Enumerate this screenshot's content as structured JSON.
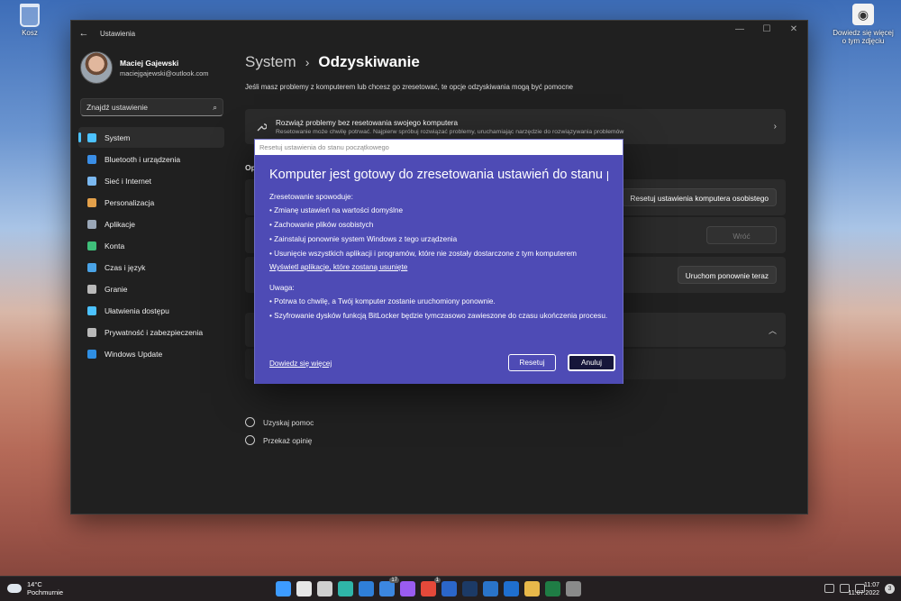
{
  "desktop": {
    "recycle_bin": "Kosz",
    "learn_more": "Dowiedz się więcej o tym zdjęciu"
  },
  "window": {
    "title": "Ustawienia",
    "controls": [
      "—",
      "☐",
      "✕"
    ]
  },
  "profile": {
    "name": "Maciej Gajewski",
    "email": "maciejgajewski@outlook.com"
  },
  "search": {
    "placeholder": "Znajdź ustawienie"
  },
  "nav": [
    {
      "label": "System",
      "icon": "monitor-icon",
      "color": "#4cc2ff"
    },
    {
      "label": "Bluetooth i urządzenia",
      "icon": "bluetooth-icon",
      "color": "#3a8ee6"
    },
    {
      "label": "Sieć i Internet",
      "icon": "wifi-icon",
      "color": "#7ab8f0"
    },
    {
      "label": "Personalizacja",
      "icon": "brush-icon",
      "color": "#e3a04a"
    },
    {
      "label": "Aplikacje",
      "icon": "apps-icon",
      "color": "#9aa7b8"
    },
    {
      "label": "Konta",
      "icon": "person-icon",
      "color": "#3fbf7a"
    },
    {
      "label": "Czas i język",
      "icon": "globe-clock-icon",
      "color": "#4aa3e6"
    },
    {
      "label": "Granie",
      "icon": "gamepad-icon",
      "color": "#b9b9b9"
    },
    {
      "label": "Ułatwienia dostępu",
      "icon": "accessibility-icon",
      "color": "#4cc2ff"
    },
    {
      "label": "Prywatność i zabezpieczenia",
      "icon": "shield-icon",
      "color": "#b9b9b9"
    },
    {
      "label": "Windows Update",
      "icon": "update-icon",
      "color": "#2f8fe3"
    }
  ],
  "main": {
    "breadcrumb_parent": "System",
    "breadcrumb_sep": "›",
    "breadcrumb_current": "Odzyskiwanie",
    "description": "Jeśli masz problemy z komputerem lub chcesz go zresetować, te opcje odzyskiwania mogą być pomocne",
    "fix_title": "Rozwiąż problemy bez resetowania swojego komputera",
    "fix_subtitle": "Resetowanie może chwilę potrwać. Najpierw spróbuj rozwiązać problemy, uruchamiając narzędzie do rozwiązywania problemów",
    "options_label": "Op",
    "reset_button": "Resetuj ustawienia komputera osobistego",
    "back_button": "Wróć",
    "restart_button": "Uruchom ponownie teraz",
    "help_link": "Uzyskaj pomoc",
    "feedback_link": "Przekaż opinię"
  },
  "dialog": {
    "titlebar": "Resetuj ustawienia do stanu początkowego",
    "heading": "Komputer jest gotowy do zresetowania ustawień do stanu p...",
    "intro": "Zresetowanie spowoduje:",
    "effects": [
      "Zmianę ustawień na wartości domyślne",
      "Zachowanie plików osobistych",
      "Zainstaluj ponownie system Windows z tego urządzenia",
      "Usunięcie wszystkich aplikacji i programów, które nie zostały dostarczone z tym komputerem"
    ],
    "apps_link": "Wyświetl aplikacje, które zostaną usunięte",
    "note_label": "Uwaga:",
    "notes": [
      "Potrwa to chwilę, a Twój komputer zostanie uruchomiony ponownie.",
      "Szyfrowanie dysków funkcją BitLocker będzie tymczasowo zawieszone do czasu ukończenia procesu."
    ],
    "learn_more": "Dowiedz się więcej",
    "reset": "Resetuj",
    "cancel": "Anuluj"
  },
  "taskbar": {
    "temperature": "14°C",
    "condition": "Pochmurnie",
    "apps": [
      {
        "icon": "windows-start-icon",
        "color": "#3d9bff",
        "badge": ""
      },
      {
        "icon": "search-icon",
        "color": "#e6e6e6",
        "badge": ""
      },
      {
        "icon": "task-view-icon",
        "color": "#cfcfcf",
        "badge": ""
      },
      {
        "icon": "edge-icon",
        "color": "#2fb5a8",
        "badge": ""
      },
      {
        "icon": "mail-icon",
        "color": "#2f7fd8",
        "badge": ""
      },
      {
        "icon": "calendar-icon",
        "color": "#3c87e0",
        "badge": "17"
      },
      {
        "icon": "messenger-icon",
        "color": "#9a5cf0",
        "badge": ""
      },
      {
        "icon": "chrome-icon",
        "color": "#e5493a",
        "badge": "1"
      },
      {
        "icon": "word-icon",
        "color": "#2b66c9",
        "badge": ""
      },
      {
        "icon": "photoshop-icon",
        "color": "#1c3a66",
        "badge": ""
      },
      {
        "icon": "trello-icon",
        "color": "#2a74c9",
        "badge": ""
      },
      {
        "icon": "outlook-icon",
        "color": "#1f6fcf",
        "badge": ""
      },
      {
        "icon": "explorer-icon",
        "color": "#e8b84a",
        "badge": ""
      },
      {
        "icon": "excel-icon",
        "color": "#1f7d45",
        "badge": ""
      },
      {
        "icon": "settings-icon",
        "color": "#8a8a8a",
        "badge": ""
      }
    ],
    "time": "11:07",
    "date": "11.07.2022",
    "notifications": "3"
  }
}
